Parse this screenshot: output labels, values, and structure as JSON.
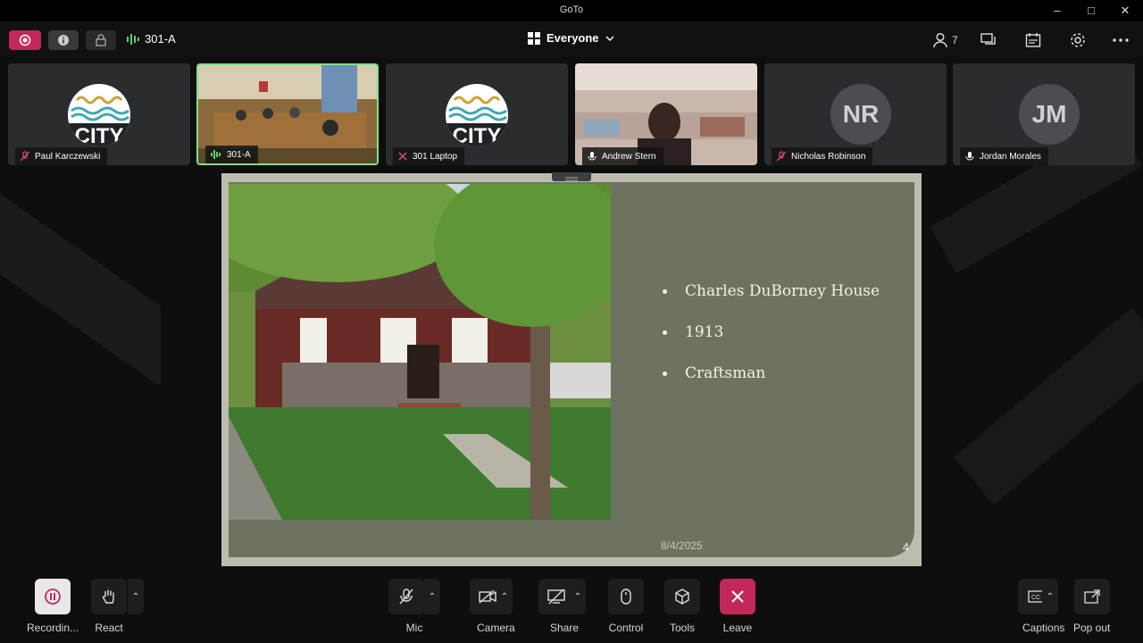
{
  "window": {
    "title": "GoTo"
  },
  "toolbar": {
    "room": "301-A",
    "view": "Everyone",
    "participant_count": "7"
  },
  "tiles": [
    {
      "name": "Paul Karczewski",
      "status": "mic-muted-icon",
      "type": "logo"
    },
    {
      "name": "301-A",
      "status": "audio-active-icon",
      "type": "video-room"
    },
    {
      "name": "301 Laptop",
      "status": "speaker-muted-icon",
      "type": "logo"
    },
    {
      "name": "Andrew Stern",
      "status": "mic-icon",
      "type": "video-person"
    },
    {
      "name": "Nicholas Robinson",
      "initials": "NR",
      "status": "mic-muted-icon",
      "type": "initials"
    },
    {
      "name": "Jordan Morales",
      "initials": "JM",
      "status": "mic-icon",
      "type": "initials"
    }
  ],
  "slide": {
    "bullets": [
      "Charles DuBorney House",
      "1913",
      "Craftsman"
    ],
    "date": "8/4/2025",
    "page": "4"
  },
  "controls": {
    "recording": "Recordin...",
    "react": "React",
    "mic": "Mic",
    "camera": "Camera",
    "share": "Share",
    "control": "Control",
    "tools": "Tools",
    "leave": "Leave",
    "captions": "Captions",
    "popout": "Pop out"
  },
  "colors": {
    "accent_record": "#c2285a",
    "active_tile_border": "#7fe08a",
    "leave": "#c2285a"
  }
}
